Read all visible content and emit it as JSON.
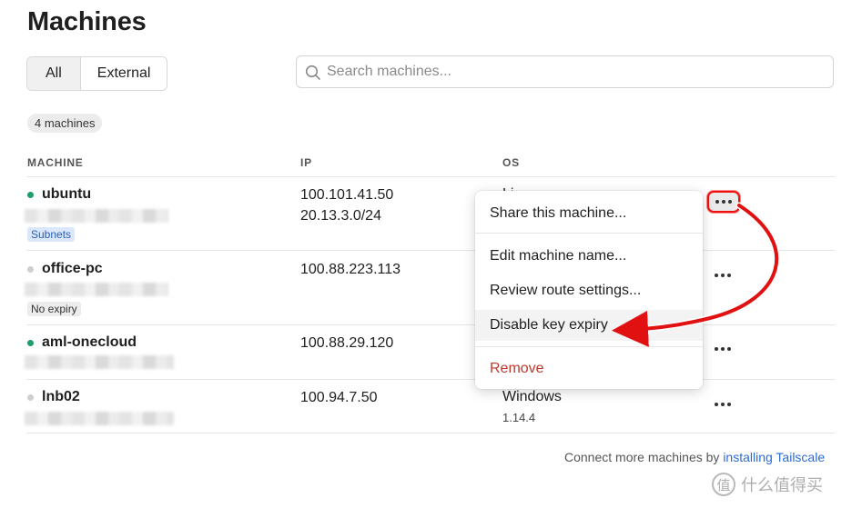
{
  "page": {
    "title": "Machines"
  },
  "filters": {
    "all": "All",
    "external": "External"
  },
  "search": {
    "placeholder": "Search machines..."
  },
  "count": "4 machines",
  "columns": {
    "machine": "MACHINE",
    "ip": "IP",
    "os": "OS"
  },
  "machines": [
    {
      "name": "ubuntu",
      "status": "online",
      "tag": "Subnets",
      "ip": "100.101.41.50",
      "ip2": "20.13.3.0/24",
      "os": "Li",
      "os_ver": ""
    },
    {
      "name": "office-pc",
      "status": "offline",
      "tag": "No expiry",
      "ip": "100.88.223.113",
      "ip2": "",
      "os": "",
      "os_ver": ""
    },
    {
      "name": "aml-onecloud",
      "status": "online",
      "tag": "",
      "ip": "100.88.29.120",
      "ip2": "",
      "os": "",
      "os_ver": ""
    },
    {
      "name": "lnb02",
      "status": "offline",
      "tag": "",
      "ip": "100.94.7.50",
      "ip2": "",
      "os": "Windows",
      "os_ver": "1.14.4"
    }
  ],
  "menu": {
    "share": "Share this machine...",
    "edit_name": "Edit machine name...",
    "review_routes": "Review route settings...",
    "disable_expiry": "Disable key expiry",
    "remove": "Remove"
  },
  "footer": {
    "text": "Connect more machines by ",
    "link": "installing Tailscale"
  },
  "watermark": {
    "logo": "值",
    "text": "什么值得买"
  },
  "colors": {
    "online": "#1e9e6a",
    "offline": "#cfcfcf",
    "accent": "#2d6bd1",
    "danger": "#c0392b",
    "annotation": "#e11111"
  }
}
